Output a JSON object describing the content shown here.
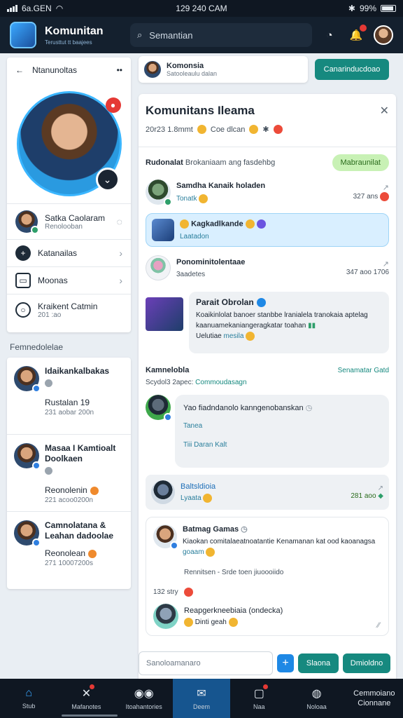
{
  "status_bar": {
    "carrier": "6a.GEN",
    "time": "129 240 CAM",
    "battery": "99%"
  },
  "header": {
    "brand": "Komunitan",
    "brand_sub": "Terusttut tt baajees",
    "search_placeholder": "Semantian"
  },
  "profile": {
    "title": "Ntanunoltas",
    "user_name": "Satka Caolaram",
    "user_sub": "Renolooban",
    "menu": [
      {
        "label": "Katanailas",
        "icon": "plus-icon"
      },
      {
        "label": "Moonas",
        "icon": "image-icon"
      }
    ],
    "extra_label": "Kraikent Catmin",
    "extra_sub": "201 :ao"
  },
  "friends_section": "Femnedolelae",
  "friends": [
    {
      "name": "Idaikankalbakas",
      "status": "Rustalan 19",
      "meta": "231 aobar 200n",
      "status_dot": false
    },
    {
      "name": "Masaa I Kamtioalt Doolkaen",
      "status": "Reonolenin",
      "meta": "221 acoo0200n",
      "status_dot": true
    },
    {
      "name": "Camnolatana & Leahan dadoolae",
      "status": "Reonolean",
      "meta": "271 10007200s",
      "status_dot": true
    }
  ],
  "topbar": {
    "card_title": "Komonsia",
    "card_sub": "Satooleaulu dalan",
    "join_button": "Canarinducdoao"
  },
  "community": {
    "title": "Komunitans Ileama",
    "meta": "20r23 1.8mmt",
    "meta_tag": "Coe dlcan",
    "section_label": "Rudonalat",
    "section_sub": "Brokaniaam ang fasdehbg",
    "pill": "Mabraunilat",
    "items": [
      {
        "title": "Samdha Kanaik holaden",
        "sub": "Tonatk",
        "right": "327 ans"
      },
      {
        "title": "Ponominitolentaae",
        "sub": "3aadetes",
        "right": "347 aoo 1706"
      }
    ],
    "highlight": {
      "title": "Kagkadlkande",
      "sub": "Laatadon"
    },
    "post": {
      "title": "Parait Obrolan",
      "body": "Koaikinlolat banoer stanbbe lranialela tranokaia aptelag kaanuamekaniangeragkatar toahan",
      "tag_prefix": "Uelutiae",
      "tag": "mesila"
    }
  },
  "comments": {
    "title": "Kamnelobla",
    "link": "Senamatar Gatd",
    "sub_prefix": "Scydol3 2apec",
    "sub_link": "Commoudasagn",
    "bubble_title": "Yao fiadndanolo kanngenobanskan",
    "bubble_line1": "Tanea",
    "bubble_line2": "Tiii Daran Kalt",
    "reply": {
      "title": "Baltsldioia",
      "sub": "Lyaata",
      "right": "281 aoo"
    },
    "thread": {
      "title": "Batmag Gamas",
      "body": "Kiaokan comitalaeatnoatantie Kenamanan kat ood kaoanagsa",
      "tag": "goaam",
      "meta": "Rennitsen - Srde toen jiuoooiido",
      "time": "132 stry",
      "reply_title": "Reapgerkneebiaia (ondecka)",
      "reply_sub": "Dinti geah"
    }
  },
  "composer": {
    "placeholder": "Sanoloamanaro",
    "button1": "Slaona",
    "button2": "Dmioldno"
  },
  "bottom_nav": [
    {
      "label": "Stub",
      "icon": "home-icon"
    },
    {
      "label": "Mafanotes",
      "icon": "tools-icon"
    },
    {
      "label": "Itoahantories",
      "icon": "users-icon"
    },
    {
      "label": "Deem",
      "icon": "chat-icon"
    },
    {
      "label": "Naa",
      "icon": "bell-icon"
    },
    {
      "label": "Noloaa",
      "icon": "bolt-icon"
    },
    {
      "label": "Cemmoiano Cionnane",
      "icon": ""
    }
  ],
  "colors": {
    "accent": "#16897f",
    "header": "#14202e",
    "nav_active": "#16558f"
  }
}
